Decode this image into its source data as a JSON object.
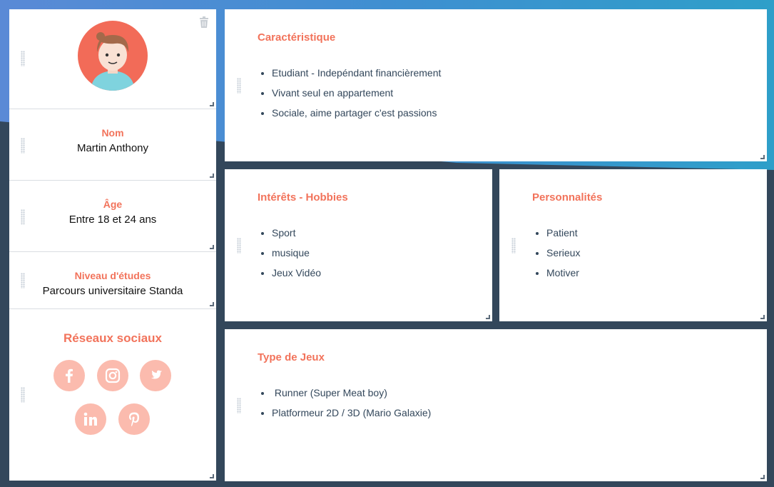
{
  "profile": {
    "name_label": "Nom",
    "name_value": "Martin Anthony",
    "age_label": "Âge",
    "age_value": "Entre 18 et 24 ans",
    "education_label": "Niveau d'études",
    "education_value": "Parcours universitaire Standa",
    "social_title": "Réseaux sociaux",
    "social_networks": [
      "facebook",
      "instagram",
      "twitter",
      "linkedin",
      "pinterest"
    ]
  },
  "characteristics": {
    "title": "Caractéristique",
    "items": [
      "Etudiant - Indepéndant financièrement",
      "Vivant seul en appartement",
      "Sociale, aime partager c'est passions"
    ]
  },
  "hobbies": {
    "title": "Intérêts - Hobbies",
    "items": [
      "Sport",
      "musique",
      "Jeux Vidéo"
    ]
  },
  "personality": {
    "title": "Personnalités",
    "items": [
      "Patient",
      "Serieux",
      "Motiver"
    ]
  },
  "games": {
    "title": "Type de Jeux",
    "items": [
      " Runner (Super Meat boy)",
      "Platformeur 2D / 3D (Mario Galaxie)"
    ]
  },
  "colors": {
    "accent": "#f2735b",
    "social_bg": "#fbbbae",
    "text": "#33475b",
    "page_bg": "#33475b"
  }
}
